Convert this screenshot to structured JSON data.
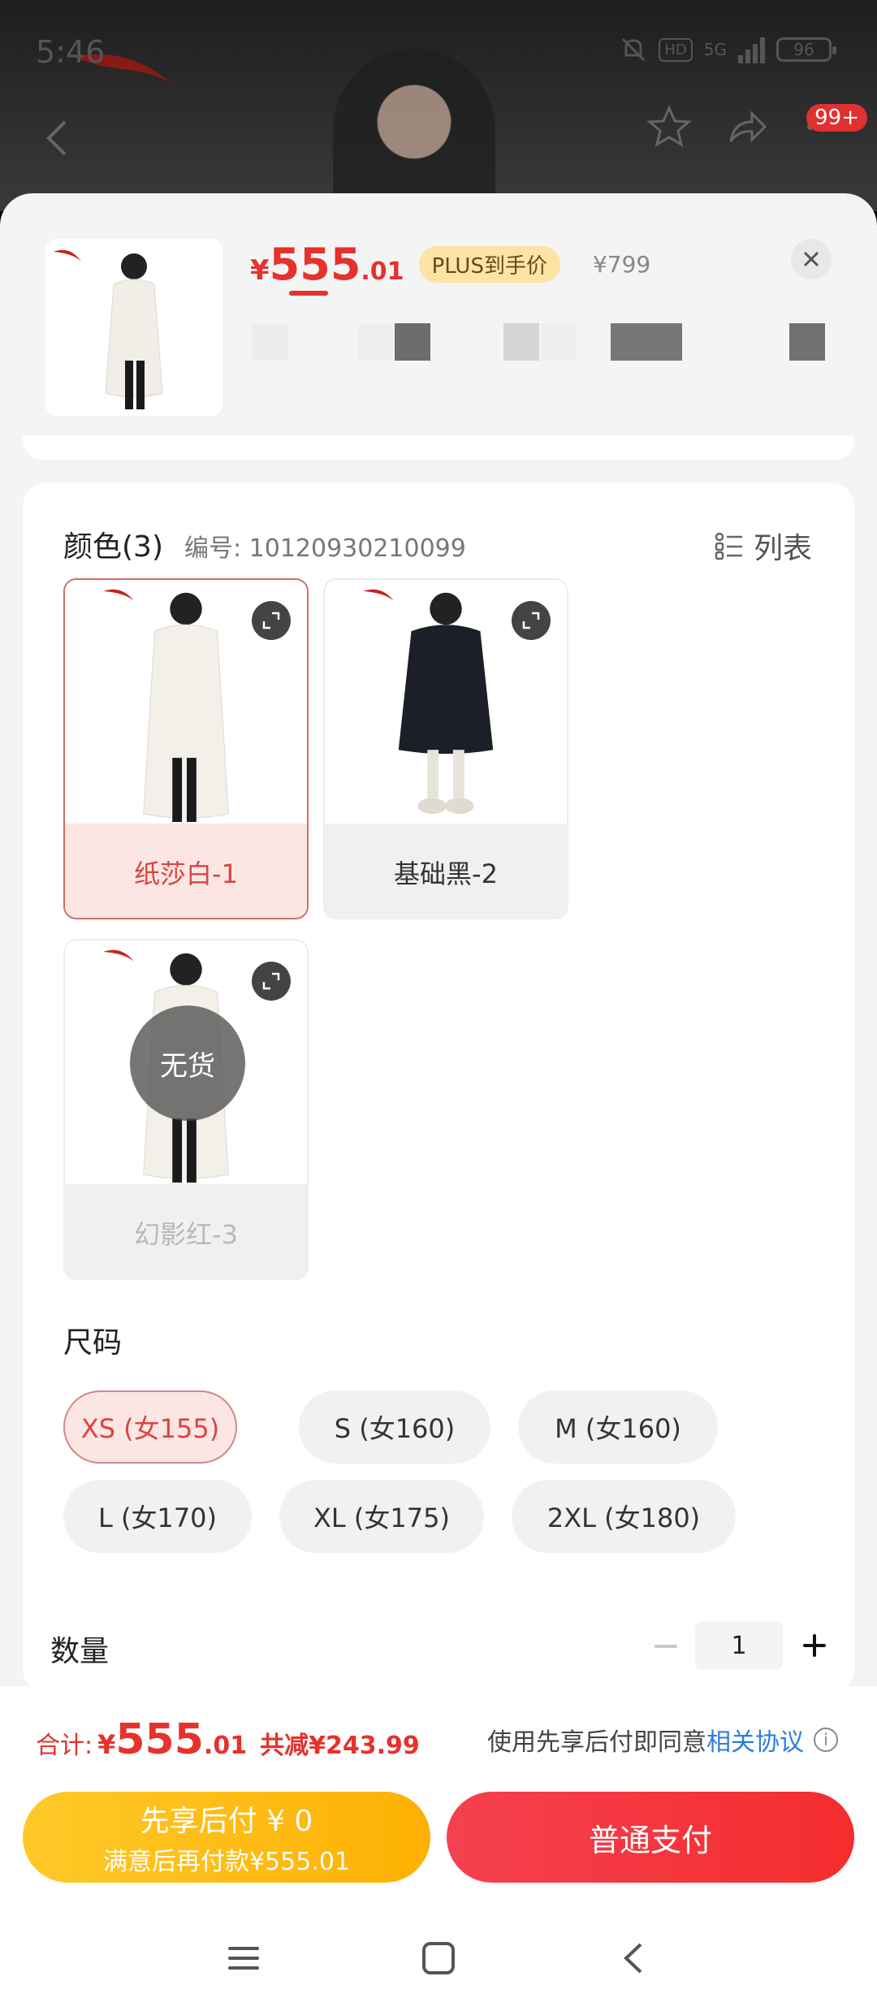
{
  "status_bar": {
    "time": "5:46",
    "hd": "HD",
    "network": "5G",
    "battery": "96"
  },
  "background_nav": {
    "badge": "99+"
  },
  "sheet": {
    "price": {
      "symbol": "¥",
      "integer": "555",
      "decimal": ".01"
    },
    "plus_tag": "PLUS到手价",
    "original_price": "¥799"
  },
  "colors": {
    "title": "颜色(3)",
    "sku": "编号: 10120930210099",
    "list_toggle": "列表",
    "variants": [
      {
        "label": "纸莎白-1",
        "selected": true,
        "sold_out": false
      },
      {
        "label": "基础黑-2",
        "selected": false,
        "sold_out": false
      },
      {
        "label": "幻影红-3",
        "selected": false,
        "sold_out": true
      }
    ],
    "sold_out_text": "无货"
  },
  "sizes": {
    "title": "尺码",
    "options": [
      {
        "label": "XS (女155)",
        "selected": true
      },
      {
        "label": "S (女160)",
        "selected": false
      },
      {
        "label": "M (女160)",
        "selected": false
      },
      {
        "label": "L (女170)",
        "selected": false
      },
      {
        "label": "XL (女175)",
        "selected": false
      },
      {
        "label": "2XL (女180)",
        "selected": false
      }
    ]
  },
  "quantity": {
    "label": "数量",
    "value": "1"
  },
  "footer": {
    "total_label": "合计:",
    "total_symbol": "¥",
    "total_integer": "555",
    "total_decimal": ".01",
    "total_savings": "共减¥243.99",
    "agree_text": "使用先享后付即同意",
    "agree_link": "相关协议",
    "info_icon": "i",
    "pay_later_line1": "先享后付 ¥ 0",
    "pay_later_line2": "满意后再付款¥555.01",
    "pay_normal": "普通支付"
  },
  "theme": {
    "accent": "#e5322d",
    "link": "#2b7de0",
    "pay_later": "#fdb003",
    "pay_normal": "#f42d2d"
  }
}
